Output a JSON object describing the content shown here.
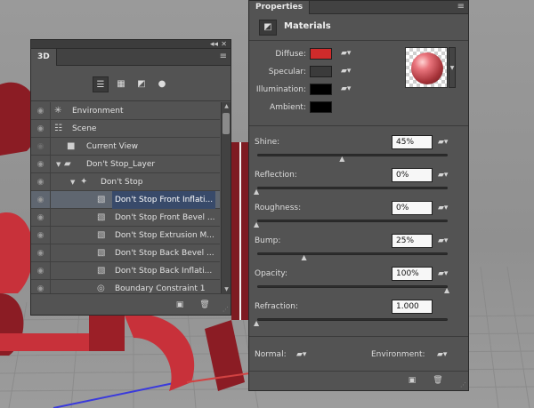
{
  "viewport": {
    "background": "3D text scene",
    "extrusion_color": "#8b1c24",
    "face_color": "#c8313a",
    "grid_color": "#8c8c8c",
    "axis_blue": "#3a3adc",
    "axis_red": "#d24242"
  },
  "panel3d": {
    "tab_label": "3D",
    "collapse_icon": "double-chevron-icon",
    "close_icon": "close-icon",
    "menu_icon": "panel-menu-icon",
    "filters": [
      "whole-scene-icon",
      "meshes-icon",
      "materials-icon",
      "lights-icon"
    ],
    "layers": [
      {
        "name": "Environment",
        "indent": 0,
        "icon": "environment-icon",
        "toggle": "",
        "visible": true,
        "selected": false
      },
      {
        "name": "Scene",
        "indent": 0,
        "icon": "scene-icon",
        "toggle": "",
        "visible": true,
        "selected": false
      },
      {
        "name": "Current View",
        "indent": 1,
        "icon": "camera-icon",
        "toggle": "",
        "visible": false,
        "selected": false
      },
      {
        "name": "Don't Stop_Layer",
        "indent": 1,
        "icon": "folder-icon",
        "toggle": "▼",
        "visible": true,
        "selected": false
      },
      {
        "name": "Don't Stop",
        "indent": 2,
        "icon": "mesh-icon",
        "toggle": "▼",
        "visible": true,
        "selected": false
      },
      {
        "name": "Don't Stop Front Inflati...",
        "indent": 3,
        "icon": "material-icon",
        "toggle": "",
        "visible": true,
        "selected": true
      },
      {
        "name": "Don't Stop Front Bevel ...",
        "indent": 3,
        "icon": "material-icon",
        "toggle": "",
        "visible": true,
        "selected": false
      },
      {
        "name": "Don't Stop Extrusion M...",
        "indent": 3,
        "icon": "material-icon",
        "toggle": "",
        "visible": true,
        "selected": false
      },
      {
        "name": "Don't Stop Back Bevel ...",
        "indent": 3,
        "icon": "material-icon",
        "toggle": "",
        "visible": true,
        "selected": false
      },
      {
        "name": "Don't Stop Back Inflati...",
        "indent": 3,
        "icon": "material-icon",
        "toggle": "",
        "visible": true,
        "selected": false
      },
      {
        "name": "Boundary Constraint 1",
        "indent": 3,
        "icon": "constraint-icon",
        "toggle": "",
        "visible": true,
        "selected": false
      }
    ],
    "footer_buttons": [
      "new-item-icon",
      "delete-icon"
    ]
  },
  "properties": {
    "tab_label": "Properties",
    "menu_icon": "panel-menu-icon",
    "section_title": "Materials",
    "section_icon": "materials-icon",
    "color_rows": [
      {
        "label": "Diffuse:",
        "color": "#cf2b2b"
      },
      {
        "label": "Specular:",
        "color": "#3b3b3b"
      },
      {
        "label": "Illumination:",
        "color": "#000000"
      },
      {
        "label": "Ambient:",
        "color": "#000000"
      }
    ],
    "sliders": [
      {
        "label": "Shine:",
        "value": "45%",
        "fraction": 0.45
      },
      {
        "label": "Reflection:",
        "value": "0%",
        "fraction": 0.0
      },
      {
        "label": "Roughness:",
        "value": "0%",
        "fraction": 0.0
      },
      {
        "label": "Bump:",
        "value": "25%",
        "fraction": 0.25
      },
      {
        "label": "Opacity:",
        "value": "100%",
        "fraction": 1.0
      },
      {
        "label": "Refraction:",
        "value": "1.000",
        "fraction": 0.0
      }
    ],
    "normal_label": "Normal:",
    "environment_label": "Environment:",
    "footer_buttons": [
      "render-icon",
      "delete-icon"
    ]
  }
}
